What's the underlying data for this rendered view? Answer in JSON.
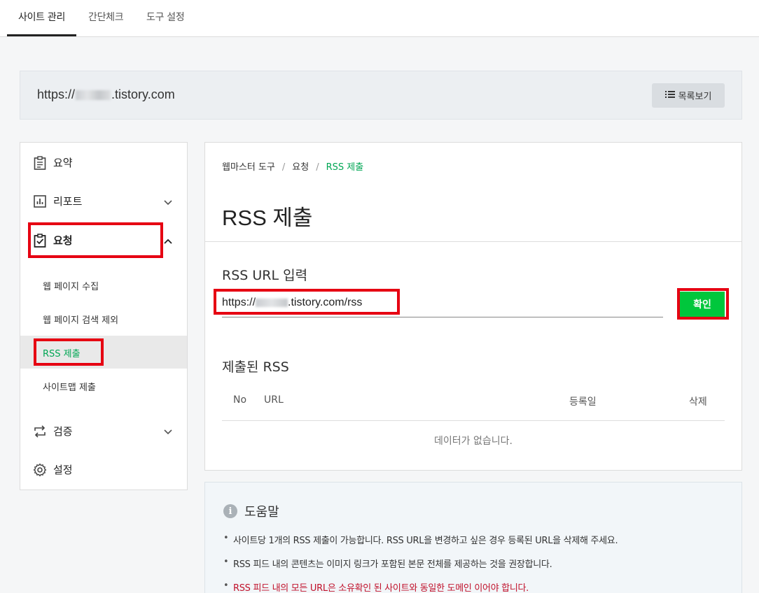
{
  "topnav": {
    "tabs": [
      {
        "label": "사이트 관리"
      },
      {
        "label": "간단체크"
      },
      {
        "label": "도구 설정"
      }
    ]
  },
  "site": {
    "url_prefix": "https://",
    "url_suffix": ".tistory.com",
    "list_button": "목록보기"
  },
  "sidebar": {
    "summary": "요약",
    "report": "리포트",
    "request": "요청",
    "sub": {
      "collect": "웹 페이지 수집",
      "exclude": "웹 페이지 검색 제외",
      "rss": "RSS 제출",
      "sitemap": "사이트맵 제출"
    },
    "verify": "검증",
    "settings": "설정"
  },
  "main": {
    "breadcrumb": [
      "웹마스터 도구",
      "요청",
      "RSS 제출"
    ],
    "title": "RSS 제출",
    "input_label": "RSS URL 입력",
    "input_prefix": "https://",
    "input_suffix": ".tistory.com/rss",
    "confirm": "확인",
    "submitted_title": "제출된 RSS",
    "columns": {
      "no": "No",
      "url": "URL",
      "date": "등록일",
      "delete": "삭제"
    },
    "empty": "데이터가 없습니다."
  },
  "help": {
    "title": "도움말",
    "items": [
      "사이트당 1개의 RSS 제출이 가능합니다. RSS URL을 변경하고 싶은 경우 등록된 URL을 삭제해 주세요.",
      "RSS 피드 내의 콘텐츠는 이미지 링크가 포함된 본문 전체를 제공하는 것을 권장합니다.",
      "RSS 피드 내의 모든 URL은 소유확인 된 사이트와 동일한 도메인 이어야 합니다."
    ]
  },
  "colors": {
    "accent": "#00c73c",
    "active_text": "#00a654",
    "highlight": "#e60012",
    "warning": "#c0102a"
  }
}
